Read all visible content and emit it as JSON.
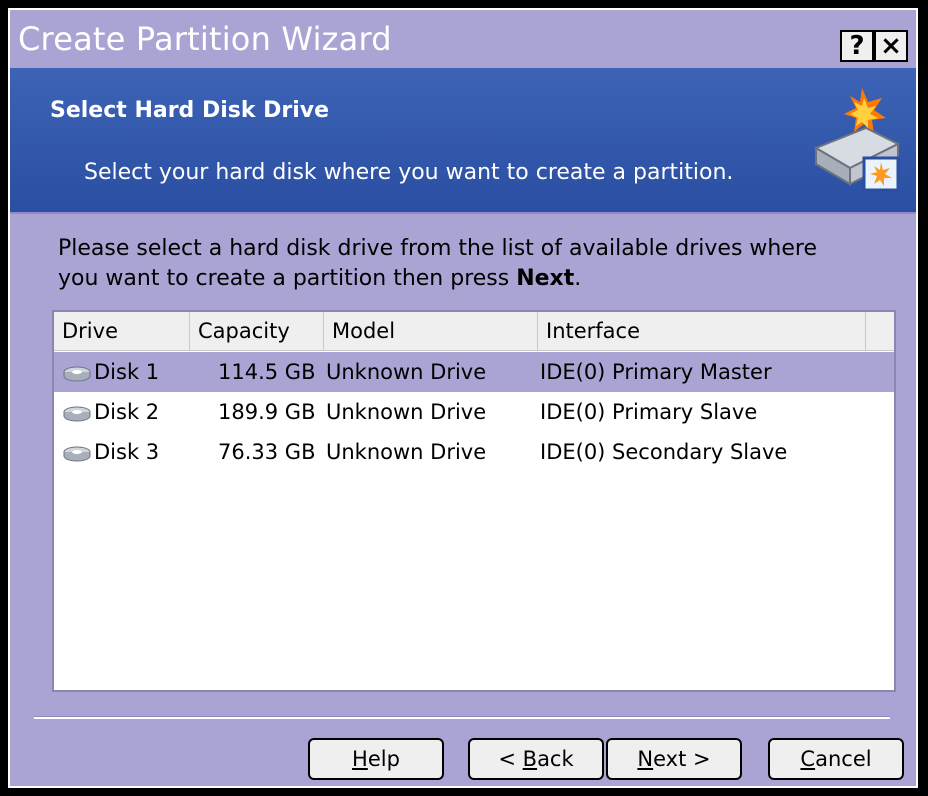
{
  "window": {
    "title": "Create Partition Wizard",
    "help_btn": "?",
    "close_btn": "×"
  },
  "header": {
    "title": "Select Hard Disk Drive",
    "subtitle": "Select your hard disk where you want to create a partition."
  },
  "instructions": {
    "line1": "Please select a hard disk drive from the list of available drives where",
    "line2_prefix": "you want to create a partition then press ",
    "line2_bold": "Next",
    "line2_suffix": "."
  },
  "table": {
    "columns": [
      "Drive",
      "Capacity",
      "Model",
      "Interface"
    ],
    "rows": [
      {
        "drive": "Disk 1",
        "capacity": "114.5 GB",
        "model": "Unknown Drive",
        "interface": "IDE(0) Primary Master",
        "selected": true
      },
      {
        "drive": "Disk 2",
        "capacity": "189.9 GB",
        "model": "Unknown Drive",
        "interface": "IDE(0) Primary Slave",
        "selected": false
      },
      {
        "drive": "Disk 3",
        "capacity": "76.33 GB",
        "model": "Unknown Drive",
        "interface": "IDE(0) Secondary Slave",
        "selected": false
      }
    ]
  },
  "buttons": {
    "help": {
      "mnemonic": "H",
      "rest": "elp"
    },
    "back": {
      "prefix": "< ",
      "mnemonic": "B",
      "rest": "ack"
    },
    "next": {
      "mnemonic": "N",
      "rest": "ext >"
    },
    "cancel": {
      "mnemonic": "C",
      "rest": "ancel"
    }
  },
  "colors": {
    "window_bg": "#aaa4d4",
    "header_bg": "#2a4fa2",
    "selected_row": "#aaa4d4"
  }
}
